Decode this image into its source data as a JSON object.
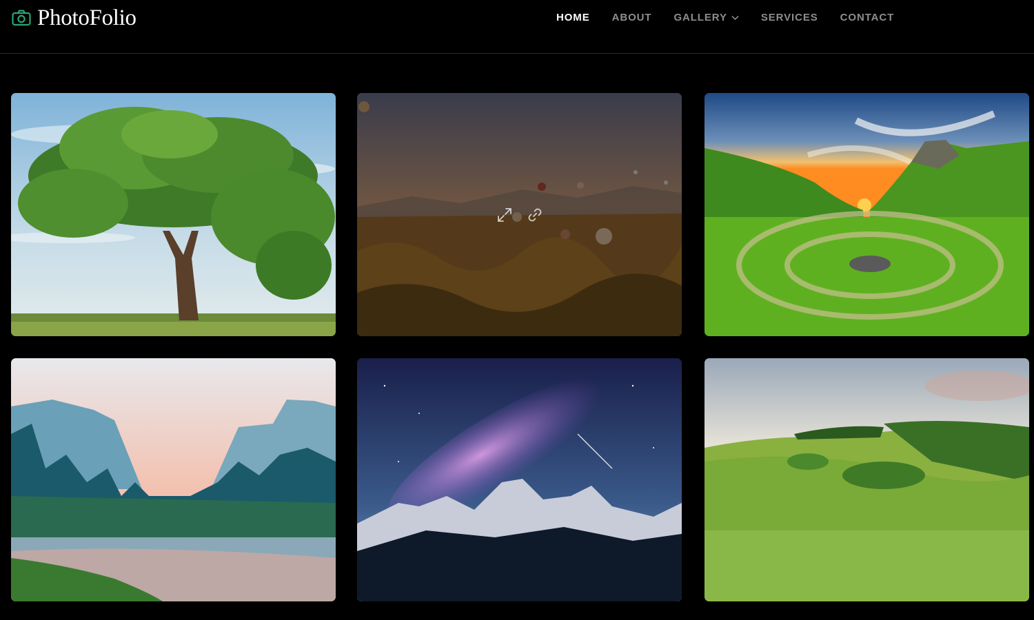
{
  "brand": {
    "name": "PhotoFolio",
    "accent": "#27a776",
    "icon": "camera-icon"
  },
  "nav": {
    "items": [
      {
        "label": "HOME",
        "active": true
      },
      {
        "label": "ABOUT"
      },
      {
        "label": "GALLERY",
        "icon": "chevron-down-icon"
      },
      {
        "label": "SERVICES"
      },
      {
        "label": "CONTACT"
      }
    ]
  },
  "gallery": {
    "items": [
      {
        "subject": "tree"
      },
      {
        "subject": "balloons",
        "hovered": true,
        "overlay_icons": [
          "expand-icon",
          "link-icon"
        ]
      },
      {
        "subject": "green-hills-sunset"
      },
      {
        "subject": "mountain-river"
      },
      {
        "subject": "milky-way"
      },
      {
        "subject": "green-meadow"
      }
    ]
  }
}
